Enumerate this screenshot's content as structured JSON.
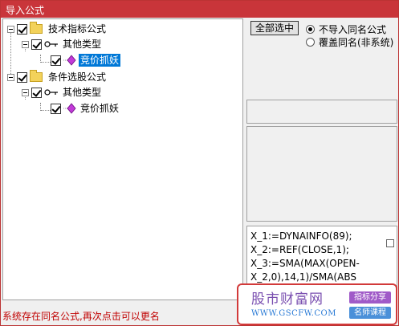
{
  "window": {
    "title": "导入公式"
  },
  "tree": {
    "group1": {
      "label": "技术指标公式",
      "child": {
        "label": "其他类型",
        "leaf": {
          "label": "竞价抓妖"
        }
      }
    },
    "group2": {
      "label": "条件选股公式",
      "child": {
        "label": "其他类型",
        "leaf": {
          "label": "竞价抓妖"
        }
      }
    }
  },
  "controls": {
    "select_all_label": "全部选中",
    "radio_skip_label": "不导入同名公式",
    "radio_overwrite_label": "覆盖同名(非系统)"
  },
  "code": {
    "lines": [
      "X_1:=DYNAINFO(89);",
      "X_2:=REF(CLOSE,1);",
      "X_3:=SMA(MAX(OPEN-",
      "X_2,0),14,1)/SMA(ABS"
    ]
  },
  "status": {
    "message": "系统存在同名公式,再次点击可以更名"
  },
  "watermark": {
    "title": "股市财富网",
    "url": "WWW.GSCFW.COM",
    "tag1": "指标分享",
    "tag2": "名师课程"
  },
  "colors": {
    "titlebar": "#c9353a",
    "selection": "#0078d7",
    "status_text": "#c00000"
  }
}
